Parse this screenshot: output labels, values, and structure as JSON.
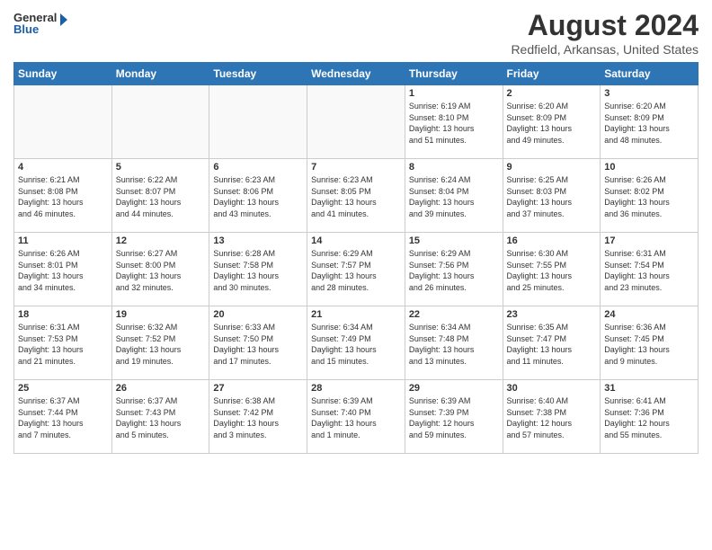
{
  "header": {
    "logo_line1": "General",
    "logo_line2": "Blue",
    "main_title": "August 2024",
    "subtitle": "Redfield, Arkansas, United States"
  },
  "weekdays": [
    "Sunday",
    "Monday",
    "Tuesday",
    "Wednesday",
    "Thursday",
    "Friday",
    "Saturday"
  ],
  "weeks": [
    [
      {
        "day": "",
        "info": ""
      },
      {
        "day": "",
        "info": ""
      },
      {
        "day": "",
        "info": ""
      },
      {
        "day": "",
        "info": ""
      },
      {
        "day": "1",
        "info": "Sunrise: 6:19 AM\nSunset: 8:10 PM\nDaylight: 13 hours\nand 51 minutes."
      },
      {
        "day": "2",
        "info": "Sunrise: 6:20 AM\nSunset: 8:09 PM\nDaylight: 13 hours\nand 49 minutes."
      },
      {
        "day": "3",
        "info": "Sunrise: 6:20 AM\nSunset: 8:09 PM\nDaylight: 13 hours\nand 48 minutes."
      }
    ],
    [
      {
        "day": "4",
        "info": "Sunrise: 6:21 AM\nSunset: 8:08 PM\nDaylight: 13 hours\nand 46 minutes."
      },
      {
        "day": "5",
        "info": "Sunrise: 6:22 AM\nSunset: 8:07 PM\nDaylight: 13 hours\nand 44 minutes."
      },
      {
        "day": "6",
        "info": "Sunrise: 6:23 AM\nSunset: 8:06 PM\nDaylight: 13 hours\nand 43 minutes."
      },
      {
        "day": "7",
        "info": "Sunrise: 6:23 AM\nSunset: 8:05 PM\nDaylight: 13 hours\nand 41 minutes."
      },
      {
        "day": "8",
        "info": "Sunrise: 6:24 AM\nSunset: 8:04 PM\nDaylight: 13 hours\nand 39 minutes."
      },
      {
        "day": "9",
        "info": "Sunrise: 6:25 AM\nSunset: 8:03 PM\nDaylight: 13 hours\nand 37 minutes."
      },
      {
        "day": "10",
        "info": "Sunrise: 6:26 AM\nSunset: 8:02 PM\nDaylight: 13 hours\nand 36 minutes."
      }
    ],
    [
      {
        "day": "11",
        "info": "Sunrise: 6:26 AM\nSunset: 8:01 PM\nDaylight: 13 hours\nand 34 minutes."
      },
      {
        "day": "12",
        "info": "Sunrise: 6:27 AM\nSunset: 8:00 PM\nDaylight: 13 hours\nand 32 minutes."
      },
      {
        "day": "13",
        "info": "Sunrise: 6:28 AM\nSunset: 7:58 PM\nDaylight: 13 hours\nand 30 minutes."
      },
      {
        "day": "14",
        "info": "Sunrise: 6:29 AM\nSunset: 7:57 PM\nDaylight: 13 hours\nand 28 minutes."
      },
      {
        "day": "15",
        "info": "Sunrise: 6:29 AM\nSunset: 7:56 PM\nDaylight: 13 hours\nand 26 minutes."
      },
      {
        "day": "16",
        "info": "Sunrise: 6:30 AM\nSunset: 7:55 PM\nDaylight: 13 hours\nand 25 minutes."
      },
      {
        "day": "17",
        "info": "Sunrise: 6:31 AM\nSunset: 7:54 PM\nDaylight: 13 hours\nand 23 minutes."
      }
    ],
    [
      {
        "day": "18",
        "info": "Sunrise: 6:31 AM\nSunset: 7:53 PM\nDaylight: 13 hours\nand 21 minutes."
      },
      {
        "day": "19",
        "info": "Sunrise: 6:32 AM\nSunset: 7:52 PM\nDaylight: 13 hours\nand 19 minutes."
      },
      {
        "day": "20",
        "info": "Sunrise: 6:33 AM\nSunset: 7:50 PM\nDaylight: 13 hours\nand 17 minutes."
      },
      {
        "day": "21",
        "info": "Sunrise: 6:34 AM\nSunset: 7:49 PM\nDaylight: 13 hours\nand 15 minutes."
      },
      {
        "day": "22",
        "info": "Sunrise: 6:34 AM\nSunset: 7:48 PM\nDaylight: 13 hours\nand 13 minutes."
      },
      {
        "day": "23",
        "info": "Sunrise: 6:35 AM\nSunset: 7:47 PM\nDaylight: 13 hours\nand 11 minutes."
      },
      {
        "day": "24",
        "info": "Sunrise: 6:36 AM\nSunset: 7:45 PM\nDaylight: 13 hours\nand 9 minutes."
      }
    ],
    [
      {
        "day": "25",
        "info": "Sunrise: 6:37 AM\nSunset: 7:44 PM\nDaylight: 13 hours\nand 7 minutes."
      },
      {
        "day": "26",
        "info": "Sunrise: 6:37 AM\nSunset: 7:43 PM\nDaylight: 13 hours\nand 5 minutes."
      },
      {
        "day": "27",
        "info": "Sunrise: 6:38 AM\nSunset: 7:42 PM\nDaylight: 13 hours\nand 3 minutes."
      },
      {
        "day": "28",
        "info": "Sunrise: 6:39 AM\nSunset: 7:40 PM\nDaylight: 13 hours\nand 1 minute."
      },
      {
        "day": "29",
        "info": "Sunrise: 6:39 AM\nSunset: 7:39 PM\nDaylight: 12 hours\nand 59 minutes."
      },
      {
        "day": "30",
        "info": "Sunrise: 6:40 AM\nSunset: 7:38 PM\nDaylight: 12 hours\nand 57 minutes."
      },
      {
        "day": "31",
        "info": "Sunrise: 6:41 AM\nSunset: 7:36 PM\nDaylight: 12 hours\nand 55 minutes."
      }
    ]
  ]
}
